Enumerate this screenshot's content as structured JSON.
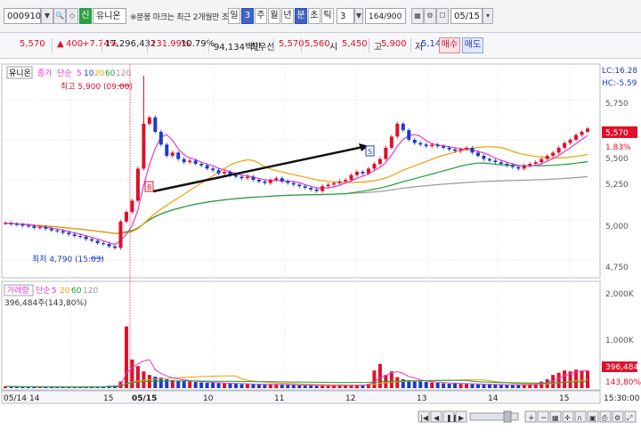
{
  "toolbar": {
    "code": "000910",
    "badge": "신",
    "stock_name": "유니온",
    "notice": "※분봉 마크는 최근 2개월만 조회",
    "period_tabs": [
      "일",
      "3",
      "주",
      "월",
      "년",
      "분",
      "초",
      "틱"
    ],
    "interval": "3",
    "count": "164/900",
    "date": "05/15"
  },
  "quote": {
    "price": "5,570",
    "change": "400",
    "change_pct": "+7.74%",
    "volume": "17,296,432",
    "vol_ratio": "131.99%",
    "turnover": "10.79%",
    "amount": "94,134백만",
    "best_label": "최우선",
    "ask": "5,570",
    "bid": "5,560",
    "open_label": "시",
    "open": "5,450",
    "high_label": "고",
    "high": "5,900",
    "low_label": "저",
    "low": "5,140",
    "buy_label": "매수",
    "sell_label": "매도"
  },
  "chart_data": {
    "type": "line",
    "title": "유니온",
    "legend": [
      "종가",
      "단순",
      "5",
      "10",
      "20",
      "60",
      "120"
    ],
    "lc": "LC:16.28",
    "hc": "HC:-5.59",
    "price_axis": [
      "5,750",
      "5,500",
      "5,250",
      "5,000",
      "4,750"
    ],
    "last_price": "5,570",
    "last_pct": "1.83%",
    "high_annotation": "최고 5,900 (09:00)",
    "low_annotation": "최저 4,790 (15:03)",
    "price_min": 4650,
    "price_max": 5950,
    "close": [
      4980,
      4975,
      4970,
      4965,
      4960,
      4950,
      4955,
      4945,
      4935,
      4930,
      4920,
      4910,
      4900,
      4895,
      4880,
      4870,
      4855,
      4850,
      4835,
      4825,
      4990,
      5050,
      5120,
      5320,
      5600,
      5640,
      5550,
      5470,
      5400,
      5420,
      5380,
      5360,
      5370,
      5350,
      5340,
      5320,
      5310,
      5290,
      5300,
      5280,
      5270,
      5260,
      5270,
      5250,
      5240,
      5230,
      5250,
      5260,
      5240,
      5230,
      5220,
      5210,
      5200,
      5190,
      5180,
      5210,
      5220,
      5230,
      5240,
      5250,
      5280,
      5300,
      5290,
      5320,
      5350,
      5380,
      5450,
      5520,
      5600,
      5560,
      5500,
      5480,
      5470,
      5460,
      5470,
      5460,
      5450,
      5440,
      5430,
      5440,
      5450,
      5420,
      5400,
      5380,
      5370,
      5360,
      5350,
      5340,
      5330,
      5320,
      5340,
      5350,
      5360,
      5380,
      5400,
      5420,
      5450,
      5480,
      5500,
      5530,
      5550,
      5570
    ],
    "volume_axis": [
      "2,000K",
      "1,000K"
    ],
    "volume_legend": [
      "거래량",
      "단순",
      "5",
      "20",
      "60",
      "120"
    ],
    "volume_info": "396,484주(143,80%)",
    "volume_last": "396,484",
    "volume_last_pct": "143,80%",
    "volume": [
      40,
      35,
      30,
      28,
      32,
      30,
      26,
      25,
      28,
      24,
      22,
      30,
      26,
      28,
      25,
      30,
      35,
      40,
      55,
      60,
      150,
      1400,
      650,
      500,
      380,
      300,
      260,
      240,
      200,
      180,
      160,
      170,
      150,
      140,
      130,
      120,
      120,
      110,
      110,
      100,
      100,
      90,
      90,
      85,
      80,
      80,
      90,
      85,
      75,
      70,
      70,
      65,
      60,
      60,
      55,
      60,
      60,
      55,
      60,
      60,
      65,
      70,
      80,
      100,
      400,
      550,
      300,
      380,
      250,
      200,
      180,
      150,
      150,
      140,
      130,
      120,
      110,
      100,
      110,
      100,
      95,
      90,
      85,
      80,
      90,
      80,
      75,
      70,
      70,
      75,
      80,
      90,
      100,
      150,
      200,
      300,
      350,
      400,
      380,
      420,
      400,
      396
    ],
    "dates": [
      "05/14",
      "14",
      "15",
      "05/15",
      "10",
      "11",
      "12",
      "13",
      "14",
      "15"
    ],
    "time_label": "15:30:00"
  },
  "colors": {
    "up": "#e0102a",
    "down": "#1a3cc8",
    "ma5": "#e23ad0",
    "ma20": "#f0a000",
    "ma60": "#1f9e3a",
    "ma120": "#9a9a9a"
  }
}
